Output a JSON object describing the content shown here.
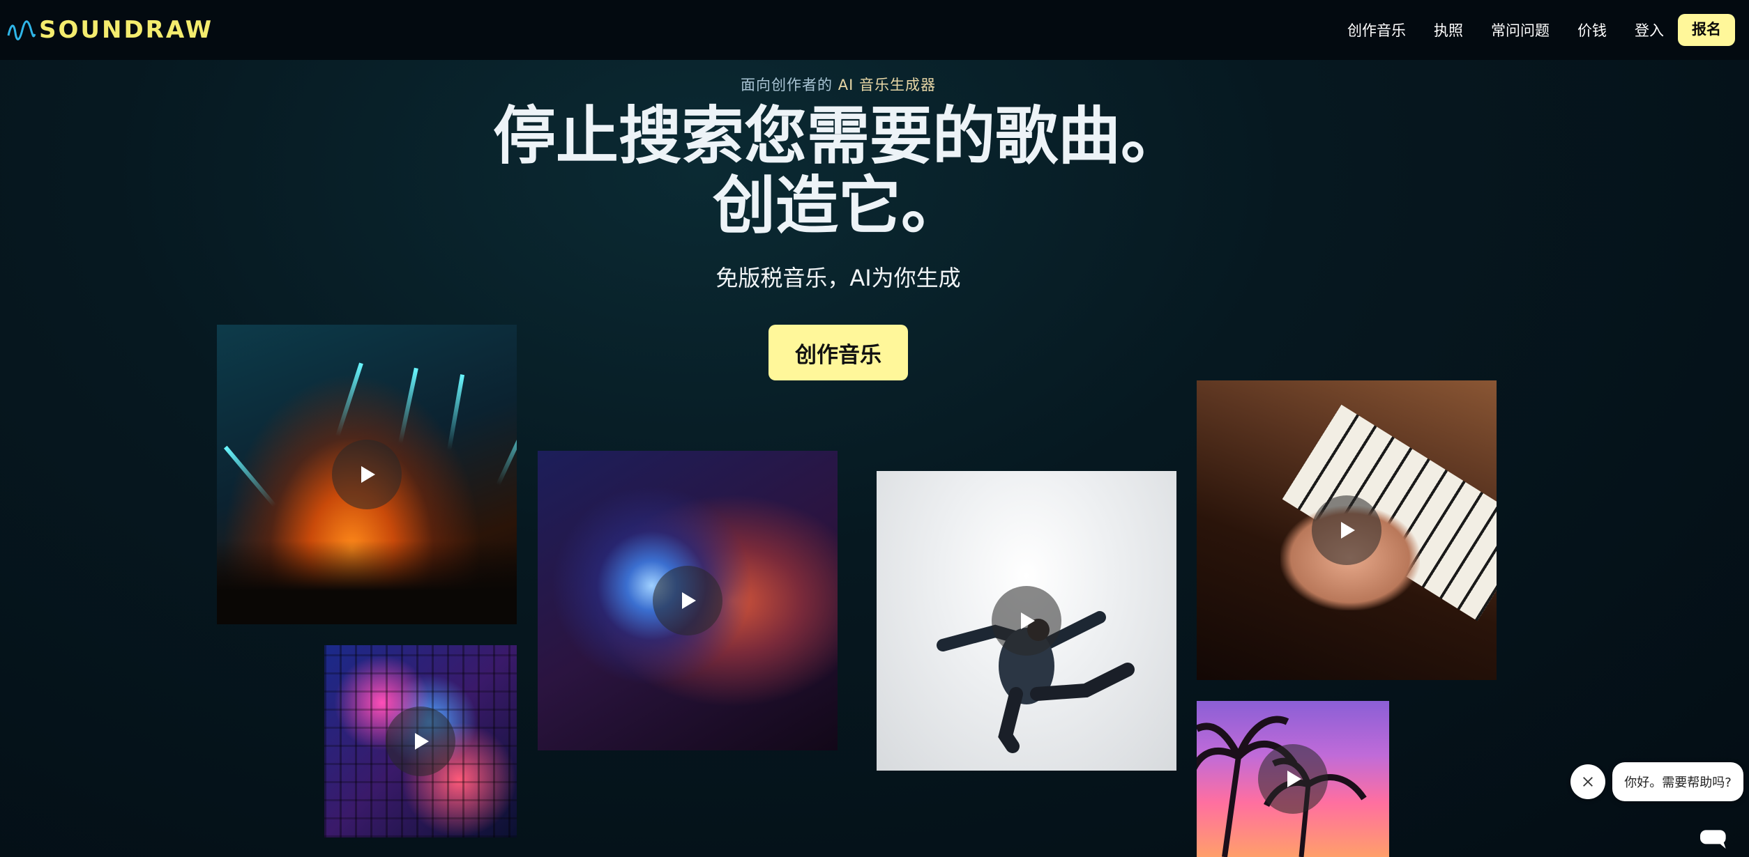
{
  "header": {
    "brand": "SOUNDRAW",
    "nav": [
      "创作音乐",
      "执照",
      "常问问题",
      "价钱",
      "登入"
    ],
    "signup_label": "报名"
  },
  "hero": {
    "eyebrow_prefix": "面向创作者的",
    "eyebrow_accent": "AI 音乐生成器",
    "title_line1": "停止搜索您需要的歌曲。",
    "title_line2": "创造它。",
    "subtitle": "免版税音乐，AI为你生成",
    "cta_label": "创作音乐"
  },
  "media_tiles": [
    {
      "name": "concert-lights",
      "icon": "play-icon"
    },
    {
      "name": "disco-ball-girl",
      "icon": "play-icon"
    },
    {
      "name": "dancer",
      "icon": "play-icon"
    },
    {
      "name": "piano",
      "icon": "play-icon"
    },
    {
      "name": "city-night",
      "icon": "play-icon"
    },
    {
      "name": "palm-sunset",
      "icon": "play-icon"
    }
  ],
  "chat": {
    "greeting": "你好。需要帮助吗?",
    "close_icon": "close-icon",
    "launcher_icon": "chat-icon"
  },
  "colors": {
    "accent": "#fff79a",
    "brand": "#f4ec6e",
    "background": "#061820"
  }
}
